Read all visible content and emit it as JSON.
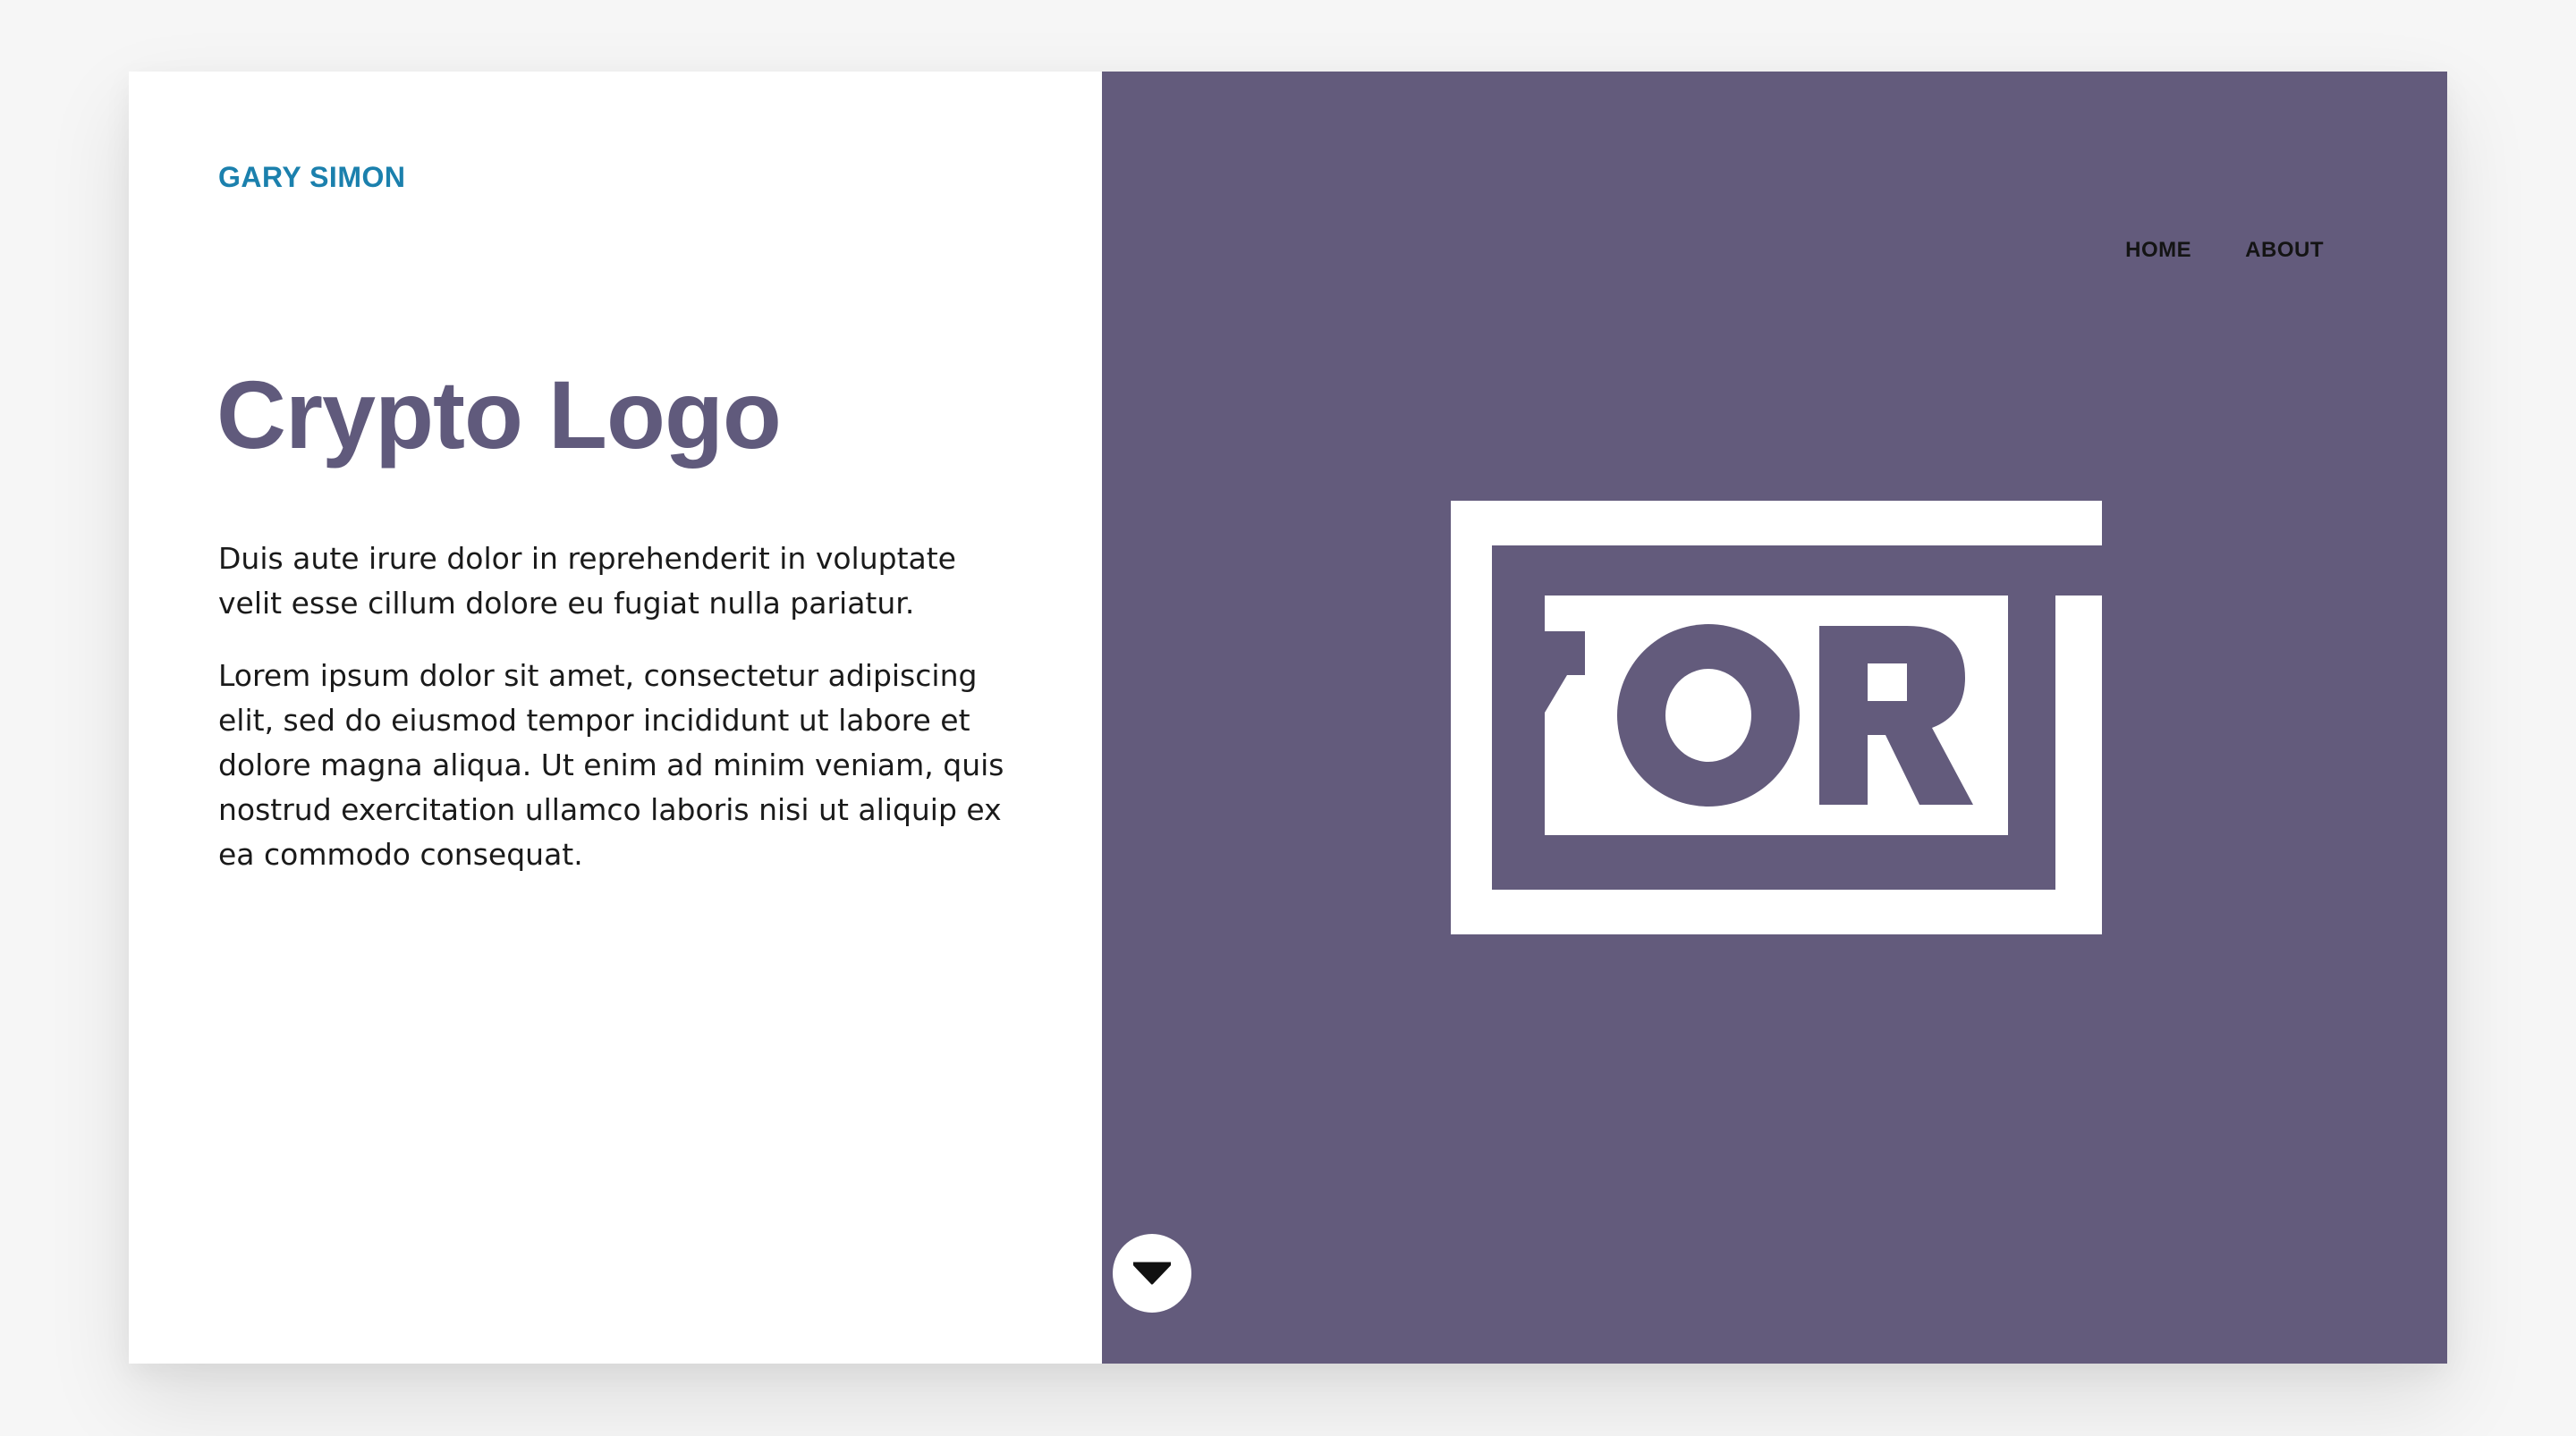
{
  "header": {
    "brand": "GARY SIMON",
    "nav": [
      {
        "label": "HOME"
      },
      {
        "label": "ABOUT"
      }
    ]
  },
  "main": {
    "title": "Crypto Logo",
    "paragraphs": [
      "Duis aute irure dolor in reprehenderit in voluptate velit esse cillum dolore eu fugiat nulla pariatur.",
      "Lorem ipsum dolor sit amet, consectetur adipiscing elit, sed do eiusmod tempor incididunt ut labore et dolore magna aliqua. Ut enim ad minim veniam, quis nostrud exercitation ullamco laboris nisi ut aliquip ex ea commodo consequat."
    ]
  },
  "hero": {
    "logo_text": "FOR",
    "logo_icon": "crypto-logo-mark"
  },
  "scroll": {
    "icon": "caret-down-icon"
  },
  "colors": {
    "background": "#f6f6f6",
    "panel_left": "#ffffff",
    "panel_right": "#635b7c",
    "brand": "#1b80ad",
    "title": "#605a7c",
    "text": "#1a1a1a"
  }
}
